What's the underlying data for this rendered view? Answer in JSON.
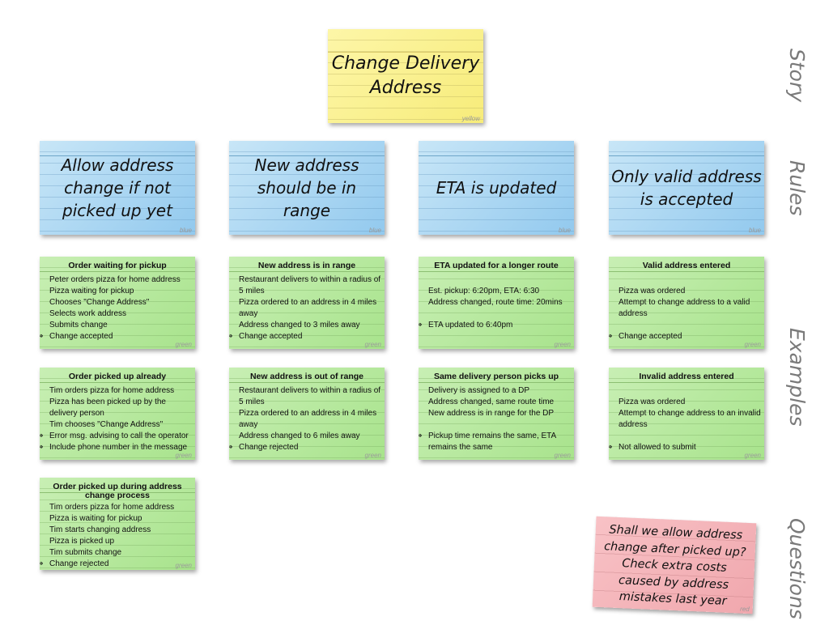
{
  "row_labels": {
    "story": "Story",
    "rules": "Rules",
    "examples": "Examples",
    "questions": "Questions"
  },
  "story": {
    "text_line1": "Change Delivery",
    "text_line2": "Address",
    "color_tag": "yellow"
  },
  "rules": [
    {
      "lines": [
        "Allow address",
        "change if not",
        "picked up yet"
      ],
      "color_tag": "blue"
    },
    {
      "lines": [
        "New address",
        "should be in",
        "range"
      ],
      "color_tag": "blue"
    },
    {
      "lines": [
        "ETA is updated"
      ],
      "color_tag": "blue"
    },
    {
      "lines": [
        "Only valid address",
        "is accepted"
      ],
      "color_tag": "blue"
    }
  ],
  "examples": [
    {
      "title": "Order waiting for pickup",
      "color_tag": "green",
      "items": [
        {
          "mark": "•",
          "text": "Peter orders pizza for home address"
        },
        {
          "mark": "•",
          "text": "Pizza waiting for pickup"
        },
        {
          "mark": "•",
          "text": "Chooses \"Change Address\""
        },
        {
          "mark": "•",
          "text": "Selects work address"
        },
        {
          "mark": "•",
          "text": "Submits change"
        },
        {
          "mark": "⇒",
          "text": "Change accepted"
        }
      ]
    },
    {
      "title": "New address is in range",
      "color_tag": "green",
      "items": [
        {
          "mark": "•",
          "text": "Restaurant delivers to within a radius of 5 miles"
        },
        {
          "mark": "•",
          "text": "Pizza ordered to an address in 4 miles away"
        },
        {
          "mark": "•",
          "text": "Address changed to 3 miles away"
        },
        {
          "mark": "⇒",
          "text": "Change accepted"
        }
      ]
    },
    {
      "title": "ETA updated for a longer route",
      "color_tag": "green",
      "items": [
        {
          "gap": true
        },
        {
          "mark": "•",
          "text": "Est. pickup: 6:20pm, ETA: 6:30"
        },
        {
          "mark": "•",
          "text": "Address changed, route time: 20mins"
        },
        {
          "gap": true
        },
        {
          "mark": "⇒",
          "text": "ETA updated to 6:40pm"
        }
      ]
    },
    {
      "title": "Valid address entered",
      "color_tag": "green",
      "items": [
        {
          "gap": true
        },
        {
          "mark": "•",
          "text": "Pizza was ordered"
        },
        {
          "mark": "•",
          "text": "Attempt to change address to a valid address"
        },
        {
          "gap": true
        },
        {
          "mark": "⇒",
          "text": "Change accepted"
        }
      ]
    },
    {
      "title": "Order picked up already",
      "color_tag": "green",
      "items": [
        {
          "mark": "•",
          "text": "Tim orders pizza for home address"
        },
        {
          "mark": "•",
          "text": "Pizza has been picked up by the delivery person"
        },
        {
          "mark": "•",
          "text": "Tim chooses \"Change Address\""
        },
        {
          "mark": "⇒",
          "text": "Error msg. advising to call the operator"
        },
        {
          "mark": "⇒",
          "text": "Include phone number in the message"
        }
      ]
    },
    {
      "title": "New address is out of range",
      "color_tag": "green",
      "items": [
        {
          "mark": "•",
          "text": "Restaurant delivers to within a radius of 5 miles"
        },
        {
          "mark": "•",
          "text": "Pizza ordered to an address in 4 miles away"
        },
        {
          "mark": "•",
          "text": "Address changed to 6 miles away"
        },
        {
          "mark": "⇒",
          "text": "Change rejected"
        }
      ]
    },
    {
      "title": "Same delivery person picks up",
      "color_tag": "green",
      "items": [
        {
          "mark": "•",
          "text": "Delivery is assigned to a DP"
        },
        {
          "mark": "•",
          "text": "Address changed, same route time"
        },
        {
          "mark": "•",
          "text": "New address is in range for the DP"
        },
        {
          "gap": true
        },
        {
          "mark": "⇒",
          "text": "Pickup time remains the same, ETA remains the same"
        }
      ]
    },
    {
      "title": "Invalid address entered",
      "color_tag": "green",
      "items": [
        {
          "gap": true
        },
        {
          "mark": "•",
          "text": "Pizza was ordered"
        },
        {
          "mark": "•",
          "text": "Attempt to change address to an invalid address"
        },
        {
          "gap": true
        },
        {
          "mark": "⇒",
          "text": "Not allowed to submit"
        }
      ]
    },
    {
      "title": "Order picked up during address change process",
      "color_tag": "green",
      "items": [
        {
          "mark": "•",
          "text": "Tim orders pizza for home address"
        },
        {
          "mark": "•",
          "text": "Pizza is waiting for pickup"
        },
        {
          "mark": "•",
          "text": "Tim starts changing address"
        },
        {
          "mark": "•",
          "text": "Pizza is picked up"
        },
        {
          "mark": "•",
          "text": "Tim submits change"
        },
        {
          "mark": "⇒",
          "text": "Change rejected"
        }
      ]
    }
  ],
  "question": {
    "lines": [
      "Shall we allow address",
      "change after picked up?",
      "Check extra costs",
      "caused by address",
      "mistakes last year"
    ],
    "color_tag": "red"
  }
}
